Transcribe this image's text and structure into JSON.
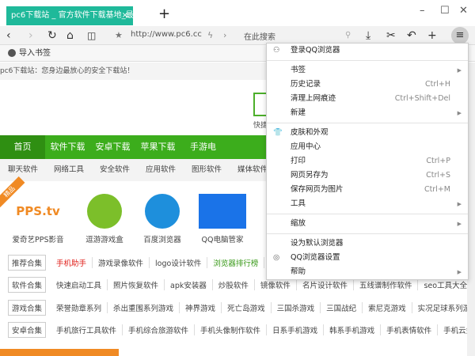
{
  "tab": {
    "title": "pc6下载站 _ 官方软件下载基地_最",
    "close": "×",
    "new": "+"
  },
  "window": {
    "min": "–",
    "max": "☐",
    "close": "✕"
  },
  "toolbar": {
    "url": "http://www.pc6.cc",
    "search_placeholder": "在此搜索"
  },
  "bookmarks": {
    "import": "导入书签"
  },
  "page": {
    "info": "pc6下载站：您身边最放心的安全下载站！",
    "quick": "快捷",
    "nav": [
      "首页",
      "软件下载",
      "安卓下载",
      "苹果下载",
      "手游电"
    ],
    "subnav": [
      "聊天软件",
      "网络工具",
      "安全软件",
      "应用软件",
      "图形软件",
      "媒体软件"
    ],
    "ribbon": "精品",
    "apps": [
      {
        "name": "爱奇艺PPS影音",
        "logo": "PPS.tv"
      },
      {
        "name": "逗游游戏盒"
      },
      {
        "name": "百度浏览器"
      },
      {
        "name": "QQ电脑管家"
      }
    ],
    "rows": [
      {
        "head": "推荐合集",
        "items": [
          "手机助手",
          "游戏录像软件",
          "logo设计软件",
          "浏览器排行榜"
        ]
      },
      {
        "head": "软件合集",
        "items": [
          "快速启动工具",
          "照片恢复软件",
          "apk安装器",
          "炒股软件",
          "镜像软件",
          "名片设计软件",
          "五线谱制作软件",
          "seo工具大全"
        ]
      },
      {
        "head": "游戏合集",
        "items": [
          "荣誉勋章系列",
          "杀出重围系列游戏",
          "神界游戏",
          "死亡岛游戏",
          "三国杀游戏",
          "三国战纪",
          "索尼克游戏",
          "实况足球系列游"
        ]
      },
      {
        "head": "安卓合集",
        "items": [
          "手机旅行工具软件",
          "手机综合旅游软件",
          "手机头像制作软件",
          "日系手机游戏",
          "韩系手机游戏",
          "手机表情软件",
          "手机云盘"
        ]
      }
    ]
  },
  "menu": {
    "groups": [
      [
        {
          "label": "登录QQ浏览器",
          "icon": "user"
        }
      ],
      [
        {
          "label": "书签",
          "sub": true
        },
        {
          "label": "历史记录",
          "shortcut": "Ctrl+H"
        },
        {
          "label": "清理上网痕迹",
          "shortcut": "Ctrl+Shift+Del"
        },
        {
          "label": "新建",
          "sub": true
        }
      ],
      [
        {
          "label": "皮肤和外观",
          "icon": "shirt"
        },
        {
          "label": "应用中心"
        },
        {
          "label": "打印",
          "shortcut": "Ctrl+P"
        },
        {
          "label": "网页另存为",
          "shortcut": "Ctrl+S"
        },
        {
          "label": "保存网页为图片",
          "shortcut": "Ctrl+M"
        },
        {
          "label": "工具",
          "sub": true
        }
      ],
      [
        {
          "label": "缩放",
          "sub": true
        }
      ],
      [
        {
          "label": "设为默认浏览器"
        },
        {
          "label": "QQ浏览器设置",
          "icon": "gear"
        },
        {
          "label": "帮助",
          "sub": true
        }
      ]
    ]
  }
}
